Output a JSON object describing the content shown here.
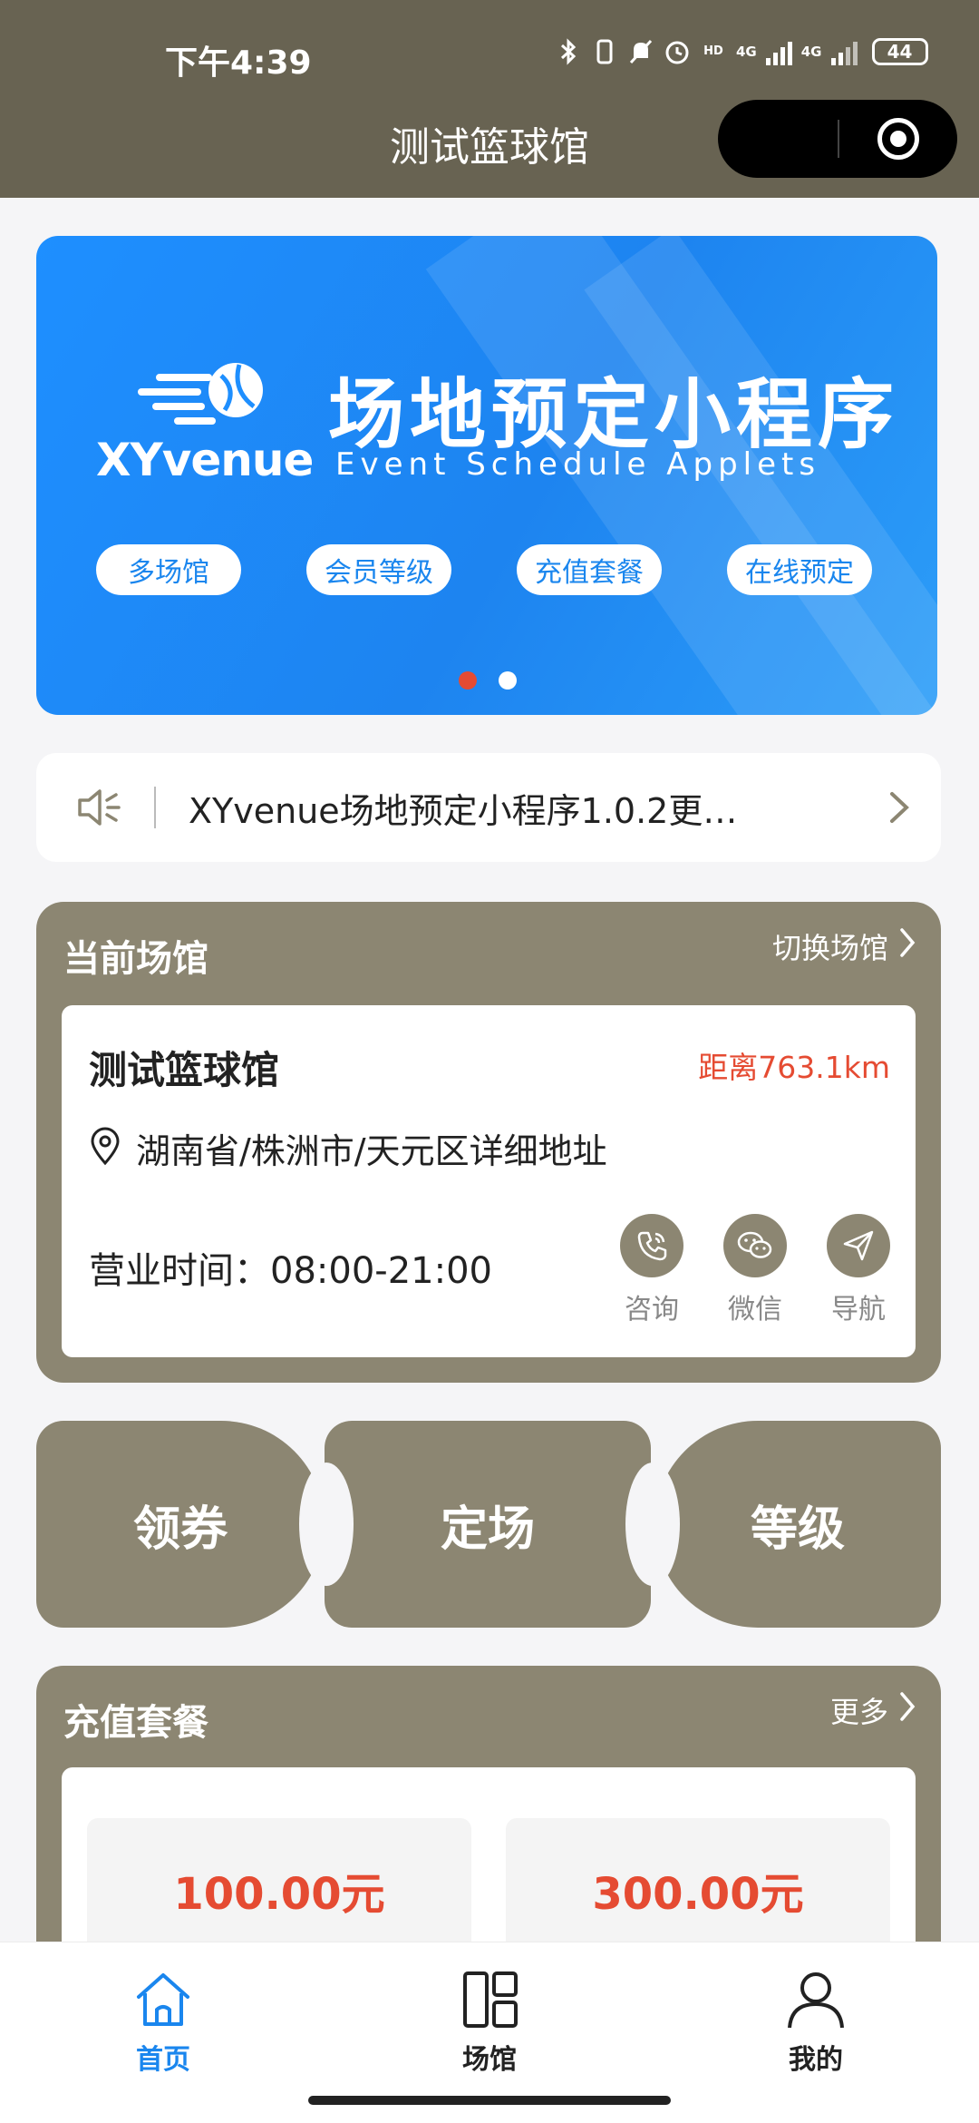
{
  "status_bar": {
    "time": "下午4:39",
    "network_1": "4G",
    "network_2": "4G",
    "battery": "44",
    "icons": [
      "bluetooth-icon",
      "vibrate-icon",
      "mute-icon",
      "alarm-icon",
      "hd-icon",
      "signal-icon",
      "battery-icon"
    ]
  },
  "header": {
    "title": "测试篮球馆"
  },
  "banner": {
    "logo_text": "XYvenue",
    "title": "场地预定小程序",
    "subtitle": "Event Schedule Applets",
    "tags": [
      "多场馆",
      "会员等级",
      "充值套餐",
      "在线预定"
    ],
    "active_dot_color": "#e54b32",
    "inactive_dot_color": "#ffffff"
  },
  "notice": {
    "text": "XYvenue场地预定小程序1.0.2更…"
  },
  "current_venue": {
    "title": "当前场馆",
    "switch_label": "切换场馆",
    "name": "测试篮球馆",
    "distance": "距离763.1km",
    "address": "湖南省/株洲市/天元区详细地址",
    "hours": "营业时间：08:00-21:00",
    "actions": [
      {
        "label": "咨询",
        "icon": "phone-icon"
      },
      {
        "label": "微信",
        "icon": "wechat-icon"
      },
      {
        "label": "导航",
        "icon": "navigation-icon"
      }
    ]
  },
  "quick_actions": {
    "coupon": "领券",
    "book": "定场",
    "level": "等级"
  },
  "recharge": {
    "title": "充值套餐",
    "more_label": "更多",
    "packages": [
      {
        "amount": "100.00元"
      },
      {
        "amount": "300.00元"
      }
    ]
  },
  "tabbar": {
    "items": [
      {
        "label": "首页",
        "icon": "home-icon",
        "active": true
      },
      {
        "label": "场馆",
        "icon": "venue-grid-icon",
        "active": false
      },
      {
        "label": "我的",
        "icon": "profile-icon",
        "active": false
      }
    ],
    "active_color": "#1a86ee",
    "inactive_color": "#222222"
  },
  "theme": {
    "primary": "#8c8672",
    "header_bg": "#686352",
    "accent_red": "#e54b32",
    "banner_blue": "#1e8fff"
  }
}
